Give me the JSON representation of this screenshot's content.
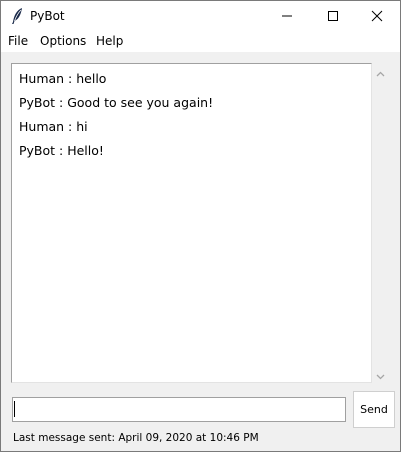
{
  "window": {
    "title": "PyBot",
    "icon": "feather-icon",
    "controls": [
      "minimize-icon",
      "maximize-icon",
      "close-icon"
    ]
  },
  "menu": {
    "items": [
      {
        "label": "File"
      },
      {
        "label": "Options"
      },
      {
        "label": "Help"
      }
    ]
  },
  "chat": {
    "messages": [
      {
        "text": "Human : hello"
      },
      {
        "text": "PyBot : Good to see you again!"
      },
      {
        "text": "Human : hi"
      },
      {
        "text": "PyBot : Hello!"
      }
    ]
  },
  "input": {
    "value": "",
    "placeholder": ""
  },
  "send_button": {
    "label": "Send"
  },
  "status": {
    "text": "Last message sent: April 09, 2020 at 10:46 PM"
  },
  "colors": {
    "background": "#f0f0f0",
    "text_area": "#ffffff",
    "border": "#a0a0a0"
  }
}
